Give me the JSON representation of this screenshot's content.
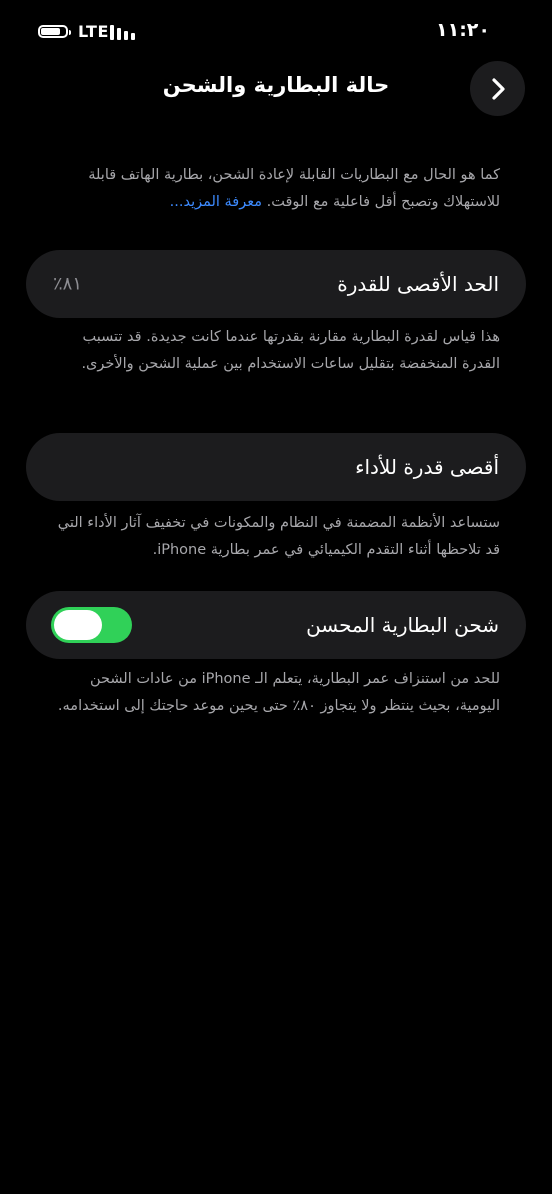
{
  "status_bar": {
    "network": "LTE",
    "time": "١١:٢٠",
    "battery_level": 0.8,
    "signal_bars": 4
  },
  "nav": {
    "title": "حالة البطارية والشحن",
    "back_icon": "chevron-right-icon"
  },
  "intro": {
    "text": "كما هو الحال مع البطاريات القابلة لإعادة الشحن، بطارية الهاتف قابلة للاستهلاك وتصبح أقل فاعلية مع الوقت.",
    "link": "معرفة المزيد..."
  },
  "max_capacity": {
    "label": "الحد الأقصى للقدرة",
    "value": "٨١٪",
    "description": "هذا قياس لقدرة البطارية مقارنة بقدرتها عندما كانت جديدة. قد تتسبب القدرة المنخفضة بتقليل ساعات الاستخدام بين عملية الشحن والأخرى."
  },
  "peak_performance": {
    "label": "أقصى قدرة للأداء",
    "description": "ستساعد الأنظمة المضمنة في النظام والمكونات في تخفيف آثار الأداء التي قد تلاحظها أثناء التقدم الكيميائي في عمر بطارية iPhone."
  },
  "optimized_charging": {
    "label": "شحن البطارية المحسن",
    "enabled": true,
    "description": "للحد من استنزاف عمر البطارية، يتعلم الـ iPhone من عادات الشحن اليومية، بحيث ينتظر ولا يتجاوز ٨٠٪ حتى يحين موعد حاجتك إلى استخدامه."
  },
  "colors": {
    "background": "#000000",
    "card": "#1c1c1e",
    "secondary_text": "#a7a7ab",
    "link": "#3d8bff",
    "toggle_on": "#30d158"
  }
}
